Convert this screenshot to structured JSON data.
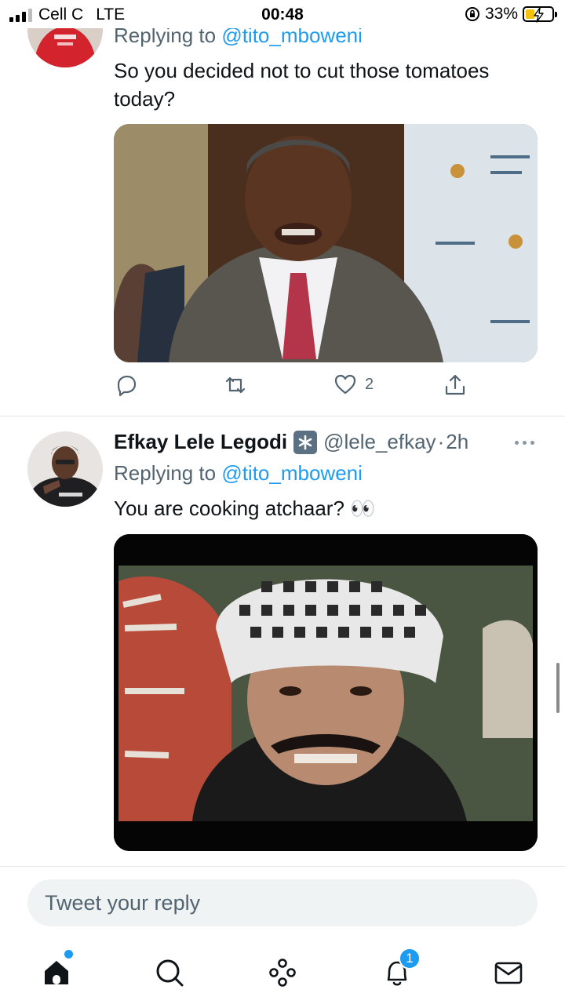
{
  "status_bar": {
    "carrier": "Cell C",
    "network": "LTE",
    "time": "00:48",
    "battery_percent": "33%",
    "battery_level": 0.33
  },
  "tweet1": {
    "reply_prefix": "Replying to ",
    "reply_handle": "@tito_mboweni",
    "text": "So you decided not to cut those tomatoes today?",
    "like_count": "2"
  },
  "tweet2": {
    "display_name": "Efkay Lele Legodi",
    "handle": "@lele_efkay",
    "separator": "·",
    "time_ago": "2h",
    "reply_prefix": "Replying to ",
    "reply_handle": "@tito_mboweni",
    "text": "You are cooking atchaar? 👀"
  },
  "reply_bar": {
    "placeholder": "Tweet your reply"
  },
  "tabbar": {
    "notification_count": "1",
    "tabs": [
      "home-icon",
      "search-icon",
      "spaces-icon",
      "notifications-icon",
      "messages-icon"
    ]
  },
  "colors": {
    "accent": "#1d9bf0",
    "secondary_text": "#536471"
  }
}
